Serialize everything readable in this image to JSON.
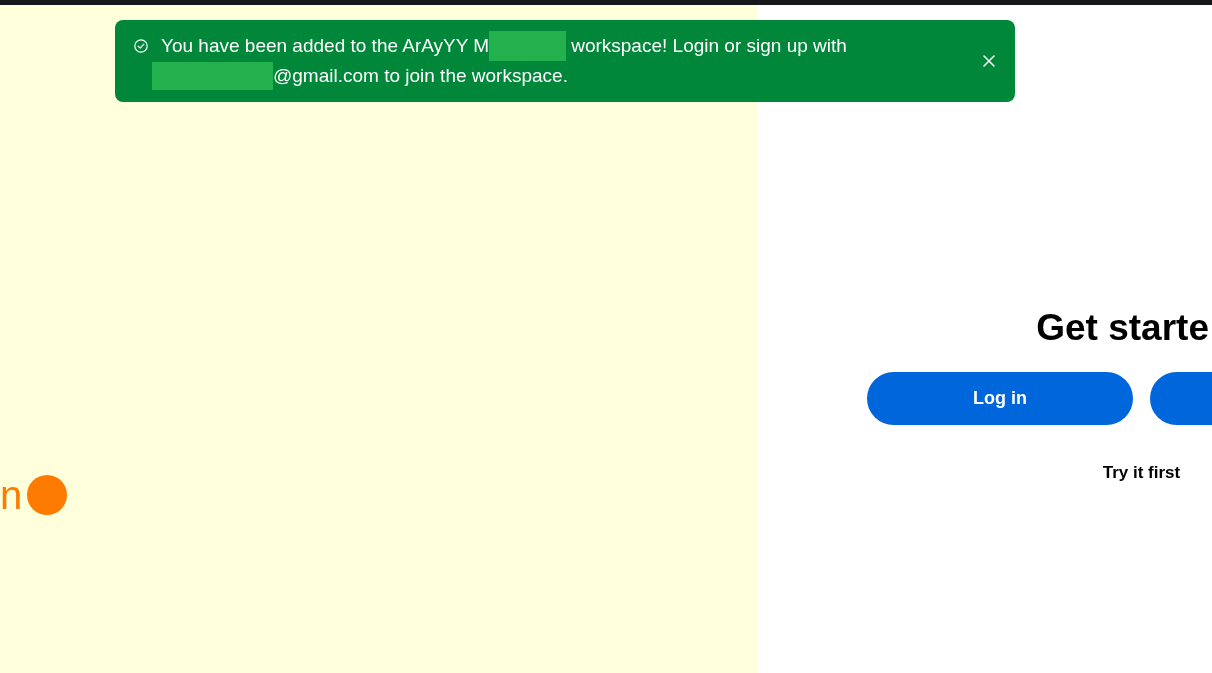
{
  "notification": {
    "kind": "success",
    "dismissible": true,
    "lines": [
      [
        {
          "kind": "text",
          "text": "You have been added to the ArAyYY M"
        },
        {
          "kind": "redacted"
        },
        {
          "kind": "text",
          "text": "workspace! Login or sign up with"
        }
      ],
      [
        {
          "kind": "redacted"
        },
        {
          "kind": "text",
          "text": "@gmail.com to join the workspace."
        }
      ]
    ]
  },
  "hero": {
    "text": "n"
  },
  "auth": {
    "heading": "Get starte",
    "buttons": [
      {
        "kind": "full",
        "label": "Log in"
      },
      {
        "kind": "clipped"
      }
    ],
    "link": "Try it first"
  }
}
